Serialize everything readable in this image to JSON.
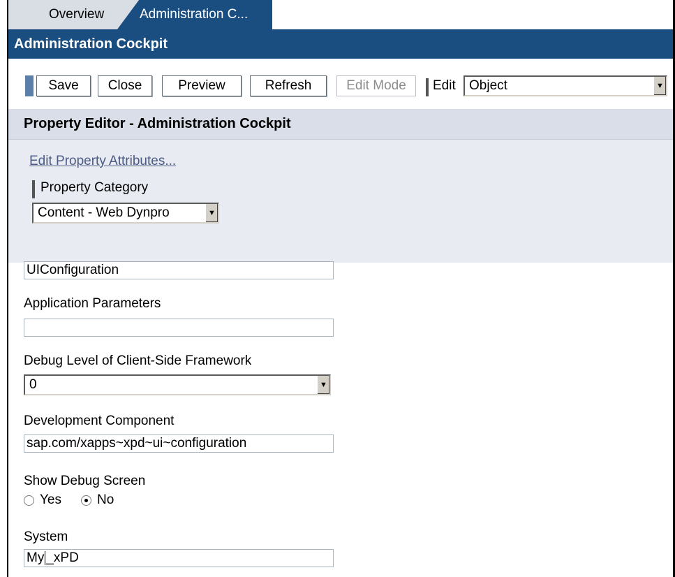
{
  "tabs": [
    {
      "label": "Overview"
    },
    {
      "label": "Administration C..."
    }
  ],
  "window": {
    "title": "Administration Cockpit"
  },
  "toolbar": {
    "buttons": [
      {
        "label": "Save"
      },
      {
        "label": "Close"
      },
      {
        "label": "Preview"
      },
      {
        "label": "Refresh"
      },
      {
        "label": "Edit Mode"
      }
    ],
    "edit_label": "Edit",
    "edit_select_value": "Object"
  },
  "property_editor": {
    "title": "Property Editor - Administration Cockpit",
    "edit_attributes_link": "Edit Property Attributes...",
    "category_label": "Property Category",
    "category_value": "Content - Web Dynpro"
  },
  "form": {
    "ui_config_value": "UIConfiguration",
    "app_params_label": "Application Parameters",
    "app_params_value": "",
    "debug_level_label": "Debug Level of Client-Side Framework",
    "debug_level_value": "0",
    "dev_component_label": "Development Component",
    "dev_component_value": "sap.com/xapps~xpd~ui~configuration",
    "show_debug_label": "Show Debug Screen",
    "show_debug_options": [
      {
        "label": "Yes",
        "checked": false
      },
      {
        "label": "No",
        "checked": true
      }
    ],
    "system_label": "System",
    "system_value_before_cursor": "My",
    "system_value_after_cursor": "_xPD"
  },
  "colors": {
    "header_blue": "#1a4e80",
    "panel_bg": "#e8ebf1",
    "link": "#4b5b84"
  }
}
